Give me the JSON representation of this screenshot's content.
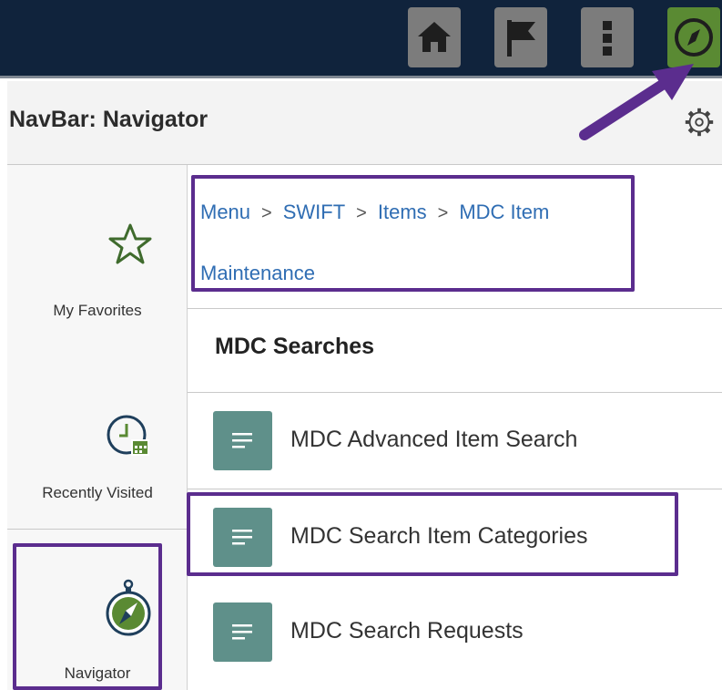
{
  "topbar": {
    "buttons": [
      {
        "icon": "home-icon"
      },
      {
        "icon": "flag-icon"
      },
      {
        "icon": "kebab-menu-icon"
      },
      {
        "icon": "compass-icon",
        "active": true
      }
    ],
    "colors": {
      "background": "#10233c",
      "button": "#7c7c7c",
      "active": "#5a8a33",
      "annotation": "#5b2d8e"
    }
  },
  "header": {
    "title": "NavBar: Navigator",
    "settings_icon": "gear-icon"
  },
  "rail": {
    "items": [
      {
        "label": "My Favorites",
        "icon": "star-icon"
      },
      {
        "label": "Recently Visited",
        "icon": "clock-calendar-icon"
      },
      {
        "label": "Navigator",
        "icon": "compass-icon"
      }
    ]
  },
  "breadcrumb": {
    "items": [
      "Menu",
      "SWIFT",
      "Items",
      "MDC Item",
      "Maintenance"
    ],
    "separator": ">"
  },
  "main": {
    "section_title": "MDC Searches",
    "items": [
      {
        "label": "MDC Advanced Item Search",
        "icon": "document-icon"
      },
      {
        "label": "MDC Search Item Categories",
        "icon": "document-icon"
      },
      {
        "label": "MDC Search Requests",
        "icon": "document-icon"
      }
    ]
  }
}
